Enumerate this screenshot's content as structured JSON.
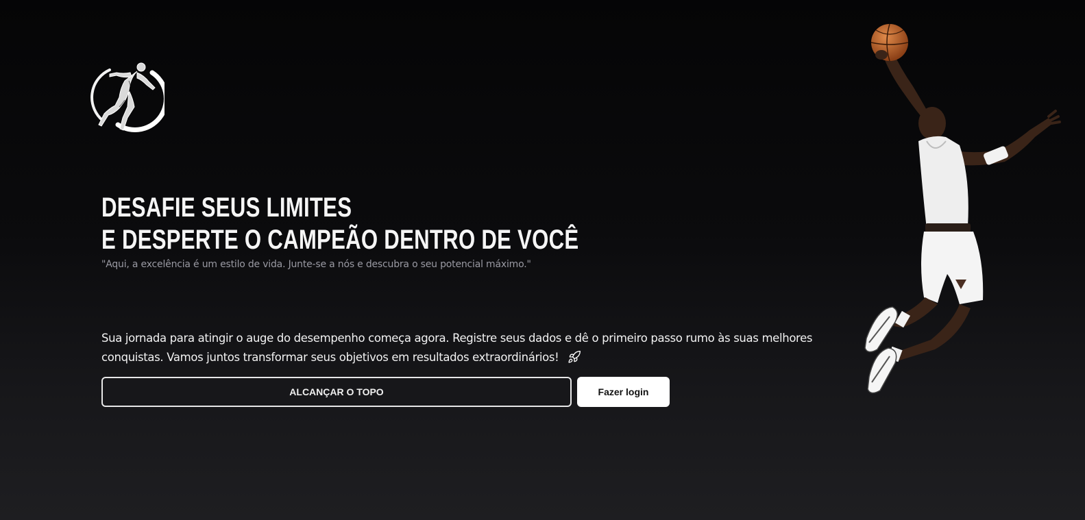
{
  "hero": {
    "headline_line1": "DESAFIE SEUS LIMITES",
    "headline_line2": "E DESPERTE O CAMPEÃO DENTRO DE VOCÊ",
    "quote": "\"Aqui, a excelência é um estilo de vida. Junte-se a nós e descubra o seu potencial máximo.\"",
    "intro": "Sua jornada para atingir o auge do desempenho começa agora. Registre seus dados e dê o primeiro passo rumo às suas melhores conquistas. Vamos juntos transformar seus objetivos em resultados extraordinários!",
    "intro_icon": "rocket-icon"
  },
  "actions": {
    "primary_label": "ALCANÇAR O TOPO",
    "secondary_label": "Fazer login"
  },
  "images": {
    "logo": "running-athlete-logo",
    "hero_image": "basketball-player-dunking"
  },
  "colors": {
    "background_top": "#050506",
    "background_bottom": "#1e1e21",
    "text_primary": "#ffffff",
    "text_muted": "#9a9aa3",
    "button_secondary_bg": "#ffffff"
  }
}
